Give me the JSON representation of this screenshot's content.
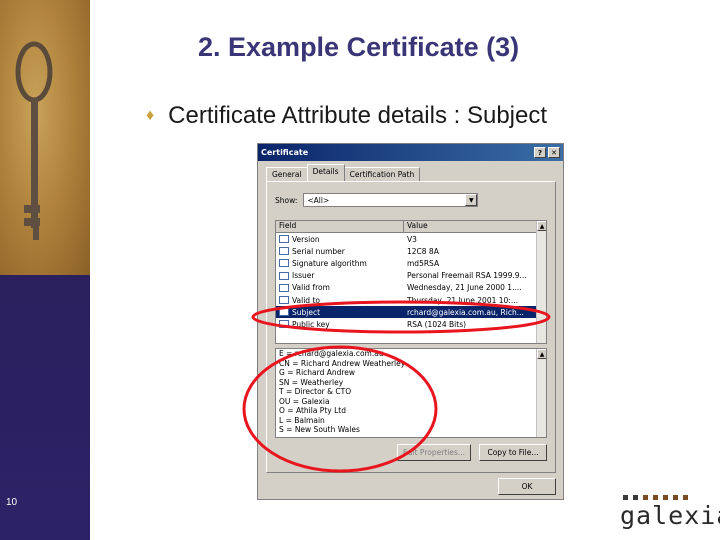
{
  "slide": {
    "title": "2. Example Certificate (3)",
    "bullet": "Certificate Attribute details : Subject",
    "number": "10",
    "logo_text": "galexia",
    "accent_color": "#3a3576",
    "bullet_color": "#c9a23a"
  },
  "dialog": {
    "title": "Certificate",
    "help_button": "?",
    "close_button": "✕",
    "tabs": [
      {
        "label": "General",
        "active": false
      },
      {
        "label": "Details",
        "active": true
      },
      {
        "label": "Certification Path",
        "active": false
      }
    ],
    "show_label": "Show:",
    "show_value": "<All>",
    "columns": {
      "field": "Field",
      "value": "Value"
    },
    "rows": [
      {
        "field": "Version",
        "value": "V3",
        "selected": false
      },
      {
        "field": "Serial number",
        "value": "12C8 8A",
        "selected": false
      },
      {
        "field": "Signature algorithm",
        "value": "md5RSA",
        "selected": false
      },
      {
        "field": "Issuer",
        "value": "Personal Freemail RSA 1999.9...",
        "selected": false
      },
      {
        "field": "Valid from",
        "value": "Wednesday, 21 June 2000 1....",
        "selected": false
      },
      {
        "field": "Valid to",
        "value": "Thursday, 21 June 2001 10:...",
        "selected": false
      },
      {
        "field": "Subject",
        "value": "rchard@galexia.com.au, Rich...",
        "selected": true
      },
      {
        "field": "Public key",
        "value": "RSA (1024 Bits)",
        "selected": false
      }
    ],
    "details": [
      "E = rchard@galexia.com.au",
      "CN = Richard Andrew Weatherley",
      "G = Richard Andrew",
      "SN = Weatherley",
      "T = Director & CTO",
      "OU = Galexia",
      "O = Athila Pty Ltd",
      "L = Balmain",
      "S = New South Wales"
    ],
    "edit_button": "Edit Properties...",
    "copy_button": "Copy to File...",
    "ok_button": "OK"
  }
}
